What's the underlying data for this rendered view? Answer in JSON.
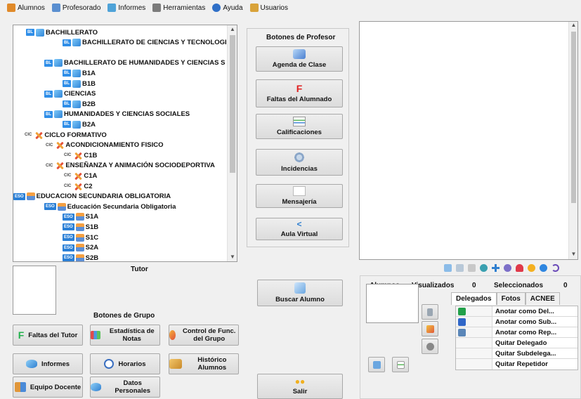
{
  "menu": [
    {
      "label": "Alumnos",
      "icon": "student-icon",
      "color": "#e08a2a"
    },
    {
      "label": "Profesorado",
      "icon": "teachers-icon",
      "color": "#5a8fd0"
    },
    {
      "label": "Informes",
      "icon": "reports-icon",
      "color": "#4fa3d8"
    },
    {
      "label": "Herramientas",
      "icon": "tools-icon",
      "color": "#7b7b7b"
    },
    {
      "label": "Ayuda",
      "icon": "help-icon",
      "color": "#2f6fc7"
    },
    {
      "label": "Usuarios",
      "icon": "users-icon",
      "color": "#d9a33a"
    }
  ],
  "tree": [
    {
      "badge": "BL",
      "icon": "book",
      "label": "BACHILLERATO"
    },
    {
      "badge": "BL",
      "icon": "book",
      "label": "BACHILLERATO DE CIENCIAS Y TECNOLOGIA"
    },
    {
      "badge": "",
      "icon": "",
      "label": ""
    },
    {
      "badge": "BL",
      "icon": "book",
      "label": "BACHILLERATO DE HUMANIDADES Y CIENCIAS S"
    },
    {
      "badge": "BL",
      "icon": "book",
      "label": "B1A"
    },
    {
      "badge": "BL",
      "icon": "book",
      "label": "B1B"
    },
    {
      "badge": "BL",
      "icon": "book",
      "label": "CIENCIAS"
    },
    {
      "badge": "BL",
      "icon": "book",
      "label": "B2B"
    },
    {
      "badge": "BL",
      "icon": "book",
      "label": "HUMANIDADES Y CIENCIAS SOCIALES"
    },
    {
      "badge": "BL",
      "icon": "book",
      "label": "B2A"
    },
    {
      "badge": "CIC",
      "icon": "x",
      "label": "CICLO FORMATIVO"
    },
    {
      "badge": "CIC",
      "icon": "x",
      "label": "ACONDICIONAMIENTO FISICO"
    },
    {
      "badge": "CIC",
      "icon": "x",
      "label": "C1B"
    },
    {
      "badge": "CIC",
      "icon": "x",
      "label": "ENSEÑANZA Y ANIMACIÓN SOCIODEPORTIVA"
    },
    {
      "badge": "CIC",
      "icon": "x",
      "label": "C1A"
    },
    {
      "badge": "CIC",
      "icon": "x",
      "label": "C2"
    },
    {
      "badge": "ESO",
      "icon": "eso",
      "label": "EDUCACION SECUNDARIA OBLIGATORIA"
    },
    {
      "badge": "ESO",
      "icon": "eso",
      "label": "Educación Secundaria Obligatoria"
    },
    {
      "badge": "ESO",
      "icon": "eso",
      "label": "S1A"
    },
    {
      "badge": "ESO",
      "icon": "eso",
      "label": "S1B"
    },
    {
      "badge": "ESO",
      "icon": "eso",
      "label": "S1C"
    },
    {
      "badge": "ESO",
      "icon": "eso",
      "label": "S2A"
    },
    {
      "badge": "ESO",
      "icon": "eso",
      "label": "S2B"
    }
  ],
  "tutor_label": "Tutor",
  "grupo": {
    "title": "Botones de Grupo",
    "buttons": [
      "Faltas del Tutor",
      "Estadística de Notas",
      "Control de Func. del Grupo",
      "Informes",
      "Horarios",
      "Histórico Alumnos",
      "Equipo Docente",
      "Datos Personales"
    ]
  },
  "profesor": {
    "title": "Botones de Profesor",
    "buttons": [
      "Agenda de Clase",
      "Faltas del Alumnado",
      "Calificaciones",
      "Incidencias",
      "Mensajería",
      "Aula Virtual"
    ],
    "faltas_glyph": "F"
  },
  "buscar_label": "Buscar Alumno",
  "salir_label": "Salir",
  "status": {
    "alumnos": "Alumnos",
    "visualizados": "Visualizados",
    "visualizados_count": "0",
    "seleccionados": "Seleccionados",
    "seleccionados_count": "0"
  },
  "tabs": [
    "Delegados",
    "Fotos",
    "ACNEE"
  ],
  "actions": [
    "Anotar como Del...",
    "Anotar como Sub...",
    "Anotar como Rep...",
    "Quitar Delegado",
    "Quitar Subdelega...",
    "Quitar Repetidor"
  ],
  "colors": {
    "accent": "#2f8ee8",
    "red": "#e02020",
    "green": "#22b14c"
  }
}
